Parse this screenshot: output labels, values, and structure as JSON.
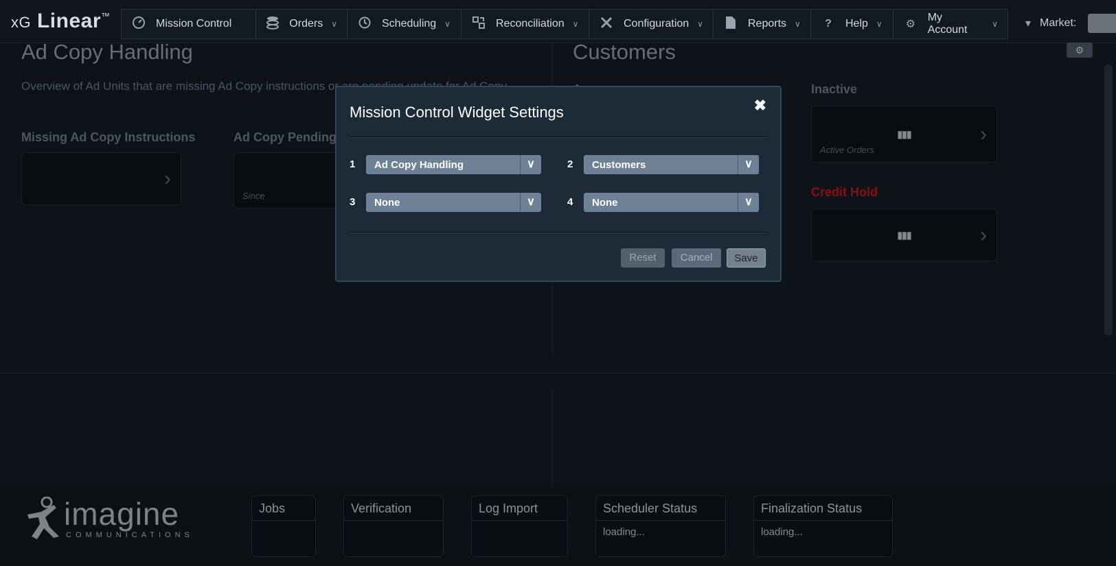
{
  "app": {
    "brand_prefix": "xG",
    "brand_name": "Linear",
    "brand_tm": "™"
  },
  "nav": {
    "items": [
      {
        "label": "Mission Control",
        "icon": "dashboard-icon",
        "has_chevron": false
      },
      {
        "label": "Orders",
        "icon": "database-icon",
        "has_chevron": true
      },
      {
        "label": "Scheduling",
        "icon": "history-icon",
        "has_chevron": true
      },
      {
        "label": "Reconciliation",
        "icon": "reconcile-icon",
        "has_chevron": true
      },
      {
        "label": "Configuration",
        "icon": "tools-icon",
        "has_chevron": true
      },
      {
        "label": "Reports",
        "icon": "document-icon",
        "has_chevron": true
      },
      {
        "label": "Help",
        "icon": "question-icon",
        "has_chevron": true
      },
      {
        "label": "My Account",
        "icon": "gear-icon",
        "has_chevron": true
      }
    ],
    "market_label": "Market:"
  },
  "left_widget": {
    "title": "Ad Copy Handling",
    "description": "Overview of Ad Units that are missing Ad Copy instructions or are pending update for Ad Copy",
    "missing_label": "Missing Ad Copy Instructions",
    "pending_label": "Ad Copy Pending Up",
    "pending_card_caption": "Since"
  },
  "right_widget": {
    "title": "Customers",
    "partial_label": "A",
    "inactive_label": "Inactive",
    "inactive_card_caption": "Active Orders",
    "credit_hold_label": "Credit Hold",
    "loading_dots": "▮▮▮"
  },
  "modal": {
    "title": "Mission Control Widget Settings",
    "slots": [
      {
        "num": "1",
        "value": "Ad Copy Handling"
      },
      {
        "num": "2",
        "value": "Customers"
      },
      {
        "num": "3",
        "value": "None"
      },
      {
        "num": "4",
        "value": "None"
      }
    ],
    "buttons": {
      "reset": "Reset",
      "cancel": "Cancel",
      "save": "Save"
    }
  },
  "footer": {
    "logo_word": "imagine",
    "logo_sub": "COMMUNICATIONS",
    "panels": [
      {
        "title": "Jobs",
        "body": ""
      },
      {
        "title": "Verification",
        "body": ""
      },
      {
        "title": "Log Import",
        "body": ""
      },
      {
        "title": "Scheduler Status",
        "body": "loading..."
      },
      {
        "title": "Finalization Status",
        "body": "loading..."
      }
    ]
  },
  "colors": {
    "credit_hold": "#c0141a",
    "modal_bg": "#1d2a38",
    "select_bg": "#6f8196"
  }
}
